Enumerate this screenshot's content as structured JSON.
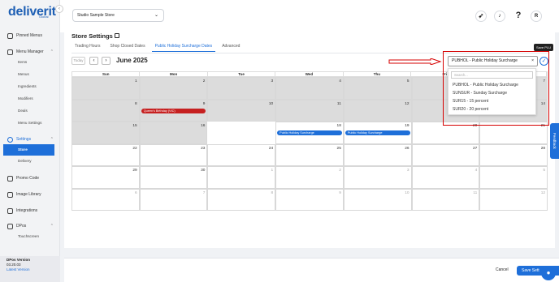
{
  "brand": {
    "logo": "deliverit",
    "sub": "Global"
  },
  "sidebar": {
    "pinned": "Pinned Menus",
    "menu_manager": "Menu Manager",
    "menu_sub": [
      "Items",
      "Menus",
      "Ingredients",
      "Modifiers",
      "Deals",
      "Menu Settings"
    ],
    "settings": "Settings",
    "settings_sub": [
      "Store",
      "Delivery"
    ],
    "promo": "Promo Code",
    "image_library": "Image Library",
    "integrations": "Integrations",
    "dpos": "DPos",
    "dpos_sub": [
      "Touchscreen"
    ],
    "version_label": "DPos Version",
    "version": "03.20.03",
    "latest": "Latest Version"
  },
  "topbar": {
    "store": "Studio Sample Store",
    "avatar": "R",
    "help": "?"
  },
  "page": {
    "title": "Store Settings",
    "tabs": [
      "Trading Hours",
      "Shop Closed Dates",
      "Public Holiday Surcharge Dates",
      "Advanced"
    ],
    "today_btn": "Today",
    "month": "June 2025",
    "weekdays": [
      "Sun",
      "Mon",
      "Tue",
      "Wed",
      "Thu",
      "Fri",
      "Sat"
    ],
    "weeks": [
      [
        {
          "d": "1",
          "s": "past"
        },
        {
          "d": "2",
          "s": "past"
        },
        {
          "d": "3",
          "s": "past"
        },
        {
          "d": "4",
          "s": "past"
        },
        {
          "d": "5",
          "s": "past"
        },
        {
          "d": "6",
          "s": "past"
        },
        {
          "d": "7",
          "s": "past"
        }
      ],
      [
        {
          "d": "8",
          "s": "past"
        },
        {
          "d": "9",
          "s": "past"
        },
        {
          "d": "10",
          "s": "past"
        },
        {
          "d": "11",
          "s": "past"
        },
        {
          "d": "12",
          "s": "past"
        },
        {
          "d": "13",
          "s": "past"
        },
        {
          "d": "14",
          "s": "past"
        }
      ],
      [
        {
          "d": "15",
          "s": "past"
        },
        {
          "d": "16",
          "s": "past"
        },
        {
          "d": "17",
          "s": "today"
        },
        {
          "d": "18",
          "s": ""
        },
        {
          "d": "19",
          "s": ""
        },
        {
          "d": "20",
          "s": ""
        },
        {
          "d": "21",
          "s": ""
        }
      ],
      [
        {
          "d": "22",
          "s": ""
        },
        {
          "d": "23",
          "s": ""
        },
        {
          "d": "24",
          "s": ""
        },
        {
          "d": "25",
          "s": ""
        },
        {
          "d": "26",
          "s": ""
        },
        {
          "d": "27",
          "s": ""
        },
        {
          "d": "28",
          "s": ""
        }
      ],
      [
        {
          "d": "29",
          "s": ""
        },
        {
          "d": "30",
          "s": ""
        },
        {
          "d": "1",
          "s": "other"
        },
        {
          "d": "2",
          "s": "other"
        },
        {
          "d": "3",
          "s": "other"
        },
        {
          "d": "4",
          "s": "other"
        },
        {
          "d": "5",
          "s": "other"
        }
      ],
      [
        {
          "d": "6",
          "s": "other"
        },
        {
          "d": "7",
          "s": "other"
        },
        {
          "d": "8",
          "s": "other"
        },
        {
          "d": "9",
          "s": "other"
        },
        {
          "d": "10",
          "s": "other"
        },
        {
          "d": "11",
          "s": "other"
        },
        {
          "d": "12",
          "s": "other"
        }
      ]
    ],
    "events": [
      {
        "week": 1,
        "day": 1,
        "label": "Queen's Birthday (VIC)",
        "color": "#c62020"
      },
      {
        "week": 2,
        "day": 3,
        "label": "Public Holiday Surcharge",
        "color": "#1e6fd9"
      },
      {
        "week": 2,
        "day": 4,
        "label": "Public Holiday Surcharge",
        "color": "#1e6fd9"
      }
    ]
  },
  "plu": {
    "selected": "PUBHOL - Public Holiday Surcharge",
    "search_placeholder": "Search...",
    "options": [
      "PUBHOL - Public Holiday Surcharge",
      "SUNSUR - Sunday Surcharge",
      "SUR15 - 15 percent",
      "SUR20 - 20 percent"
    ],
    "tooltip": "Save PLU"
  },
  "footer": {
    "cancel": "Cancel",
    "save": "Save Sett"
  },
  "feedback": "Feedback",
  "colors": {
    "accent": "#1e6fd9",
    "highlight": "#d60000"
  }
}
